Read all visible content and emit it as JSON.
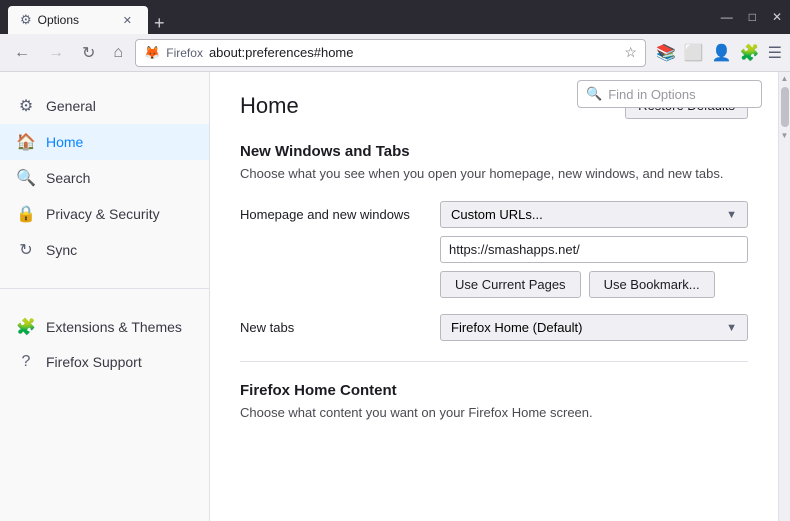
{
  "titlebar": {
    "tab_label": "Options",
    "new_tab_icon": "+",
    "minimize": "—",
    "maximize": "□",
    "close": "✕"
  },
  "navbar": {
    "back": "←",
    "forward": "→",
    "reload": "↻",
    "home": "⌂",
    "url_prefix": "Firefox",
    "url": "about:preferences#home",
    "star": "☆"
  },
  "find_bar": {
    "placeholder": "Find in Options",
    "icon": "🔍"
  },
  "sidebar": {
    "items": [
      {
        "id": "general",
        "label": "General",
        "icon": "⚙"
      },
      {
        "id": "home",
        "label": "Home",
        "icon": "⌂",
        "active": true
      },
      {
        "id": "search",
        "label": "Search",
        "icon": "🔍"
      },
      {
        "id": "privacy",
        "label": "Privacy & Security",
        "icon": "🔒"
      },
      {
        "id": "sync",
        "label": "Sync",
        "icon": "↻"
      }
    ],
    "bottom_items": [
      {
        "id": "extensions",
        "label": "Extensions & Themes",
        "icon": "🧩"
      },
      {
        "id": "support",
        "label": "Firefox Support",
        "icon": "?"
      }
    ]
  },
  "content": {
    "title": "Home",
    "restore_btn": "Restore Defaults",
    "section1_title": "New Windows and Tabs",
    "section1_desc": "Choose what you see when you open your homepage, new windows, and new tabs.",
    "homepage_label": "Homepage and new windows",
    "homepage_dropdown": "Custom URLs...",
    "homepage_url": "https://smashapps.net/",
    "use_current_pages": "Use Current Pages",
    "use_bookmark": "Use Bookmark...",
    "new_tabs_label": "New tabs",
    "new_tabs_dropdown": "Firefox Home (Default)",
    "section2_title": "Firefox Home Content",
    "section2_desc": "Choose what content you want on your Firefox Home screen."
  }
}
